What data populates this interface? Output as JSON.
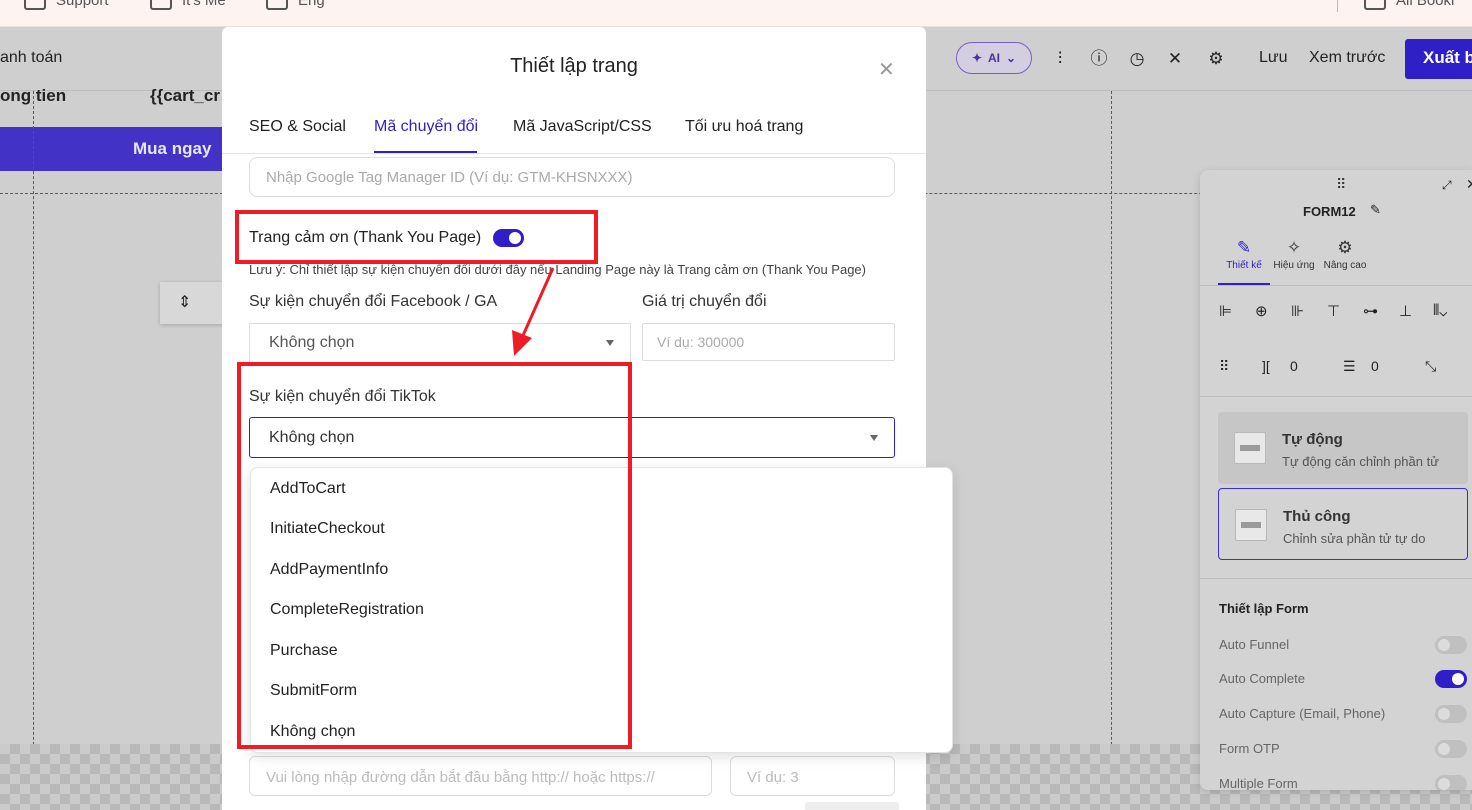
{
  "top_strip": {
    "tabs": [
      "Support",
      "It's Me",
      "Eng",
      "All Booki"
    ]
  },
  "toolbar": {
    "breadcrumb_partial": "anh toán",
    "ai_label": "AI",
    "save_label": "Lưu",
    "preview_label": "Xem trước",
    "export_label": "Xuất b"
  },
  "canvas": {
    "text_left": "ong tien",
    "text_var": "{{cart_cr",
    "buy_button": "Mua ngay"
  },
  "modal": {
    "title": "Thiết lập trang",
    "tabs": [
      {
        "label": "SEO & Social"
      },
      {
        "label": "Mã chuyển đổi"
      },
      {
        "label": "Mã JavaScript/CSS"
      },
      {
        "label": "Tối ưu hoá trang"
      }
    ],
    "gtm_placeholder": "Nhập Google Tag Manager ID (Ví dụ: GTM-KHSNXXX)",
    "thank_you_label": "Trang cảm ơn (Thank You Page)",
    "thank_you_enabled": true,
    "note": "Lưu ý: Chỉ thiết lập sự kiện chuyển đổi dưới đây nếu Landing Page này là Trang cảm ơn (Thank You Page)",
    "fb_event_label": "Sự kiện chuyển đổi Facebook / GA",
    "fb_event_value": "Không chọn",
    "conversion_value_label": "Giá trị chuyển đổi",
    "conversion_value_placeholder": "Ví dụ: 300000",
    "tiktok_event_label": "Sự kiện chuyển đổi TikTok",
    "tiktok_event_value": "Không chọn",
    "tiktok_options": [
      "AddToCart",
      "InitiateCheckout",
      "AddPaymentInfo",
      "CompleteRegistration",
      "Purchase",
      "SubmitForm",
      "Không chọn"
    ],
    "url_placeholder": "Vui lòng nhập đường dẫn bắt đầu bằng http:// hoặc https://",
    "delay_placeholder": "Ví dụ: 3"
  },
  "right_panel": {
    "title": "FORM12",
    "tabs": [
      "Thiết kế",
      "Hiệu ứng",
      "Nâng cao"
    ],
    "spacing_h": "0",
    "spacing_v": "0",
    "mode_auto_title": "Tự động",
    "mode_auto_desc": "Tự động căn chỉnh phần tử",
    "mode_manual_title": "Thủ công",
    "mode_manual_desc": "Chỉnh sửa phần tử tự do",
    "section_title": "Thiết lập Form",
    "options": [
      {
        "label": "Auto Funnel",
        "on": false
      },
      {
        "label": "Auto Complete",
        "on": true
      },
      {
        "label": "Auto Capture (Email, Phone)",
        "on": false
      },
      {
        "label": "Form OTP",
        "on": false
      },
      {
        "label": "Multiple Form",
        "on": false
      }
    ]
  },
  "colors": {
    "accent": "#2f1fc9",
    "annotation": "#ee1c24"
  }
}
